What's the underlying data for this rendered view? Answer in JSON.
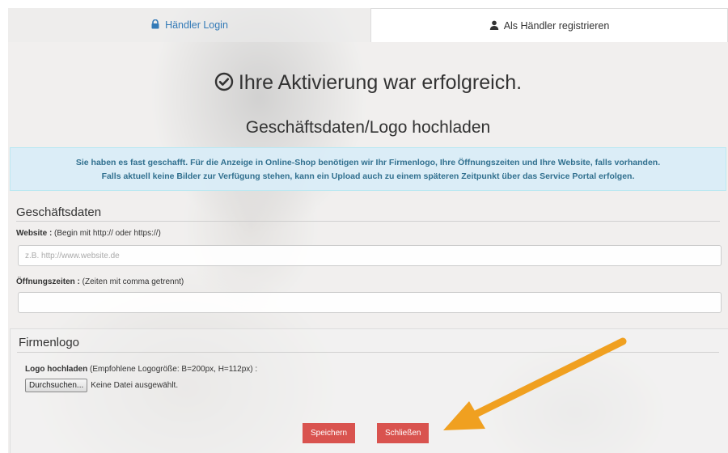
{
  "tabs": {
    "login": {
      "label": "Händler Login",
      "icon": "lock-icon"
    },
    "register": {
      "label": "Als Händler registrieren",
      "icon": "user-icon"
    }
  },
  "success_heading": "Ihre Aktivierung war erfolgreich.",
  "subtitle": "Geschäftsdaten/Logo hochladen",
  "alert": {
    "line1": "Sie haben es fast geschafft. Für die Anzeige in Online-Shop benötigen wir Ihr Firmenlogo, Ihre Öffnungszeiten und Ihre Website, falls vorhanden.",
    "line2": "Falls aktuell keine Bilder zur Verfügung stehen, kann ein Upload auch zu einem späteren Zeitpunkt über das Service Portal erfolgen."
  },
  "business": {
    "title": "Geschäftsdaten",
    "website": {
      "label": "Website :",
      "hint": " (Begin mit http:// oder https://)",
      "value": "",
      "placeholder": "z.B. http://www.website.de"
    },
    "hours": {
      "label": "Öffnungszeiten :",
      "hint": " (Zeiten mit comma getrennt)",
      "value": "",
      "placeholder": ""
    }
  },
  "logo": {
    "title": "Firmenlogo",
    "upload_label": "Logo hochladen",
    "upload_hint": " (Empfohlene Logogröße: B=200px, H=112px) :",
    "browse_button": "Durchsuchen...",
    "no_file": "Keine Datei ausgewählt."
  },
  "buttons": {
    "save": "Speichern",
    "close": "Schließen"
  },
  "colors": {
    "link_blue": "#337ab7",
    "alert_bg": "#d9edf7",
    "alert_text": "#31708f",
    "button_red": "#d9534f",
    "arrow_orange": "#f0a020"
  }
}
